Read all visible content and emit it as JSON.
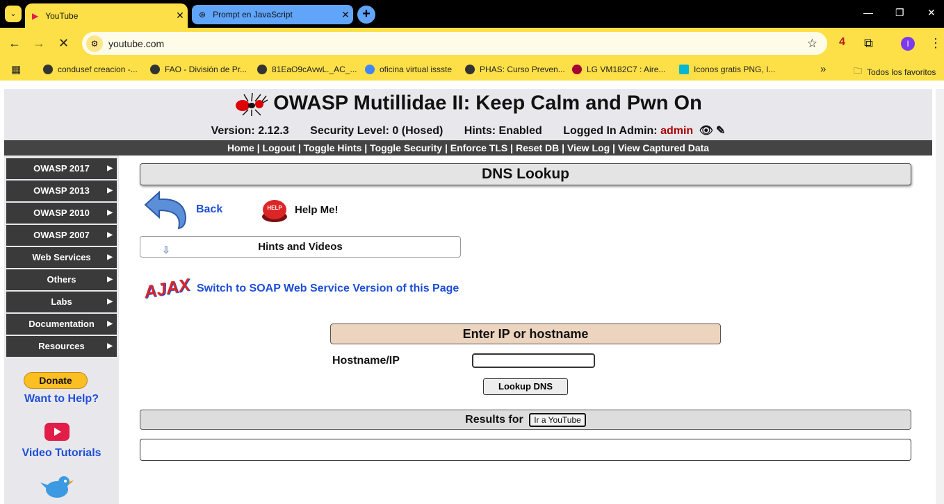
{
  "browser": {
    "tabs": [
      {
        "title": "YouTube",
        "active": true
      },
      {
        "title": "Prompt en JavaScript",
        "active": false
      }
    ],
    "url": "youtube.com",
    "profile_initial": "I",
    "ext_badge": "4",
    "bookmarks": [
      "condusef creacion -...",
      "FAO - División de Pr...",
      "81EaO9cAvwL._AC_...",
      "oficina virtual issste",
      "PHAS: Curso Preven...",
      "LG VM182C7 : Aire...",
      "Iconos gratis PNG, I...",
      "Todos los favoritos"
    ]
  },
  "header": {
    "title": "OWASP Mutillidae II: Keep Calm and Pwn On",
    "version": "Version: 2.12.3",
    "security": "Security Level: 0 (Hosed)",
    "hints": "Hints: Enabled",
    "logged_in": "Logged In Admin:",
    "user": "admin"
  },
  "nav": [
    "Home",
    "Logout",
    "Toggle Hints",
    "Toggle Security",
    "Enforce TLS",
    "Reset DB",
    "View Log",
    "View Captured Data"
  ],
  "sidebar": {
    "menus": [
      "OWASP 2017",
      "OWASP 2013",
      "OWASP 2010",
      "OWASP 2007",
      "Web Services",
      "Others",
      "Labs",
      "Documentation",
      "Resources"
    ],
    "donate": "Donate",
    "want_help": "Want to Help?",
    "video_tutorials": "Video Tutorials"
  },
  "main": {
    "heading": "DNS Lookup",
    "back": "Back",
    "help": "Help Me!",
    "help_badge": "HELP",
    "hints_videos": "Hints and Videos",
    "ajax_logo": "AJAX",
    "soap_link": "Switch to SOAP Web Service Version of this Page",
    "form_header": "Enter IP or hostname",
    "hostname_label": "Hostname/IP",
    "hostname_value": "",
    "lookup_button": "Lookup DNS",
    "results_label": "Results for",
    "results_button": "Ir a YouTube"
  }
}
